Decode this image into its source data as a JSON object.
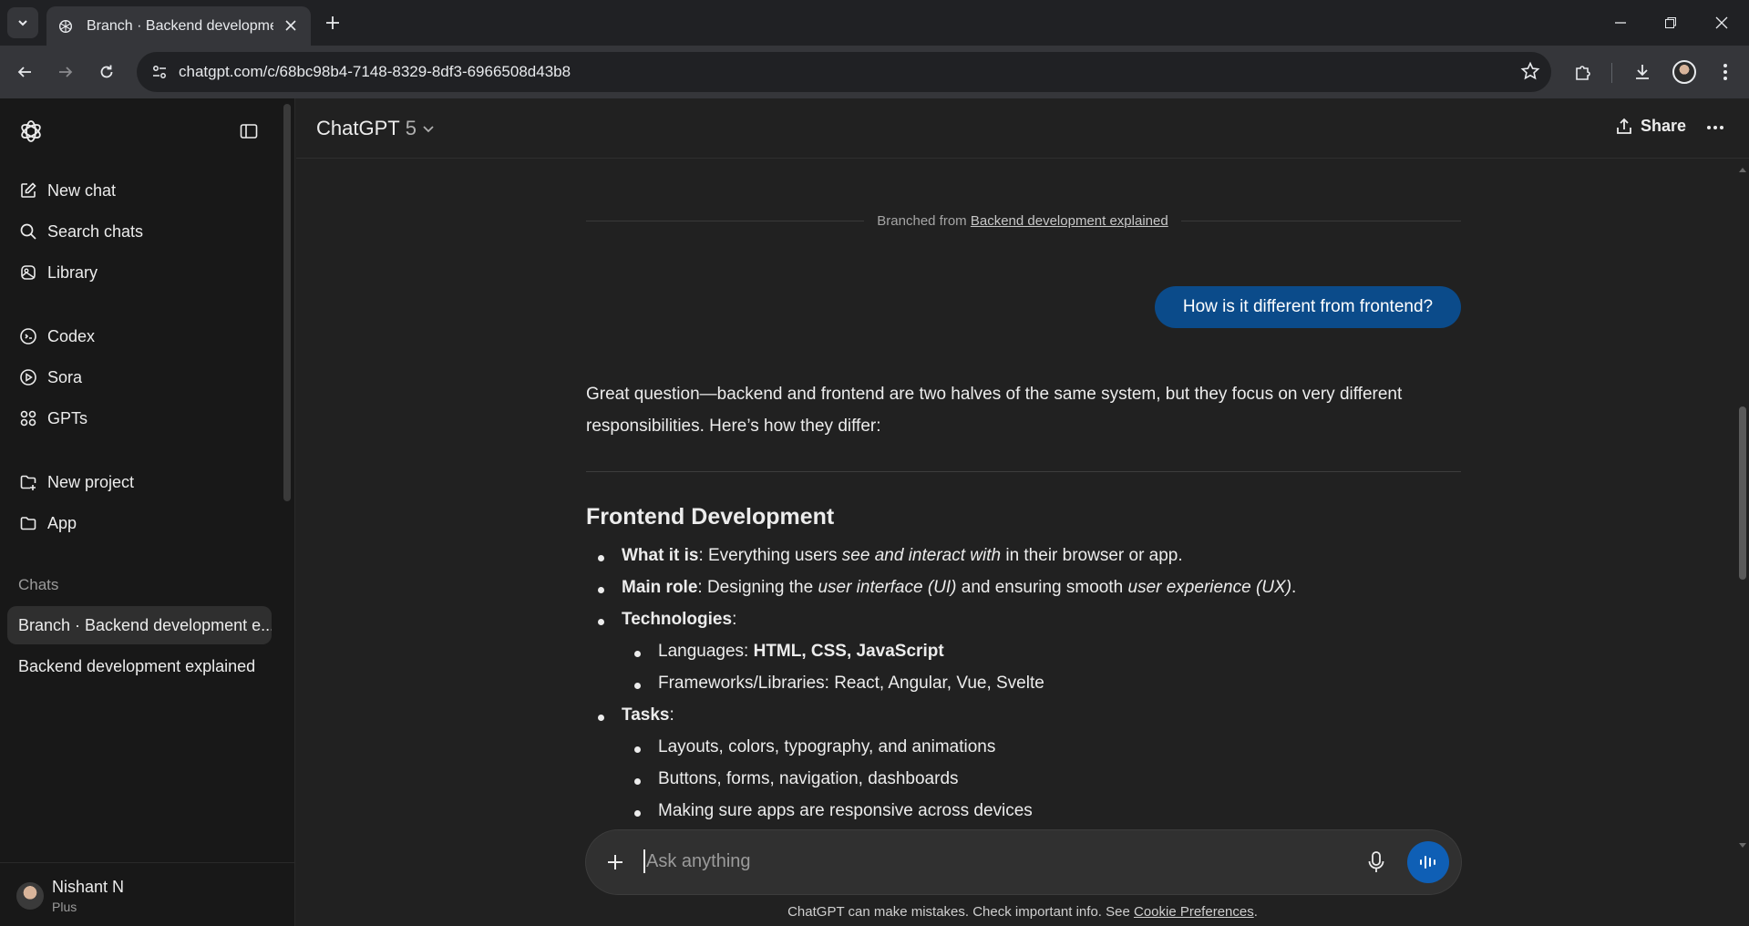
{
  "browser": {
    "tab_title": "Branch · Backend development explained",
    "url": "chatgpt.com/c/68bc98b4-7148-8329-8df3-6966508d43b8"
  },
  "sidebar": {
    "nav": [
      {
        "label": "New chat",
        "icon": "edit-icon"
      },
      {
        "label": "Search chats",
        "icon": "search-icon"
      },
      {
        "label": "Library",
        "icon": "library-icon"
      },
      {
        "label": "Codex",
        "icon": "codex-icon"
      },
      {
        "label": "Sora",
        "icon": "play-circle-icon"
      },
      {
        "label": "GPTs",
        "icon": "grid-icon"
      },
      {
        "label": "New project",
        "icon": "new-folder-icon"
      },
      {
        "label": "App",
        "icon": "folder-icon"
      }
    ],
    "chats_heading": "Chats",
    "chats": [
      {
        "title": "Branch · Backend development e..."
      },
      {
        "title": "Backend development explained"
      }
    ],
    "user": {
      "name": "Nishant N",
      "plan": "Plus"
    }
  },
  "header": {
    "model": "ChatGPT",
    "version": "5",
    "share_label": "Share"
  },
  "conversation": {
    "branch_prefix": "Branched from",
    "branch_link": "Backend development explained",
    "user_message": "How is it different from frontend?",
    "answer_intro": "Great question—backend and frontend are two halves of the same system, but they focus on very different responsibilities. Here’s how they differ:",
    "section_title": "Frontend Development",
    "items": {
      "what_label": "What it is",
      "what_a": ": Everything users ",
      "what_em": "see and interact with",
      "what_b": " in their browser or app.",
      "role_label": "Main role",
      "role_a": ": Designing the ",
      "role_em1": "user interface (UI)",
      "role_b": " and ensuring smooth ",
      "role_em2": "user experience (UX)",
      "role_c": ".",
      "tech_label": "Technologies",
      "tech_colon": ":",
      "lang_prefix": "Languages: ",
      "lang_value": "HTML, CSS, JavaScript",
      "frameworks": "Frameworks/Libraries: React, Angular, Vue, Svelte",
      "tasks_label": "Tasks",
      "tasks_colon": ":",
      "task1": "Layouts, colors, typography, and animations",
      "task2": "Buttons, forms, navigation, dashboards",
      "task3": "Making sure apps are responsive across devices"
    }
  },
  "composer": {
    "placeholder": "Ask anything"
  },
  "footer": {
    "disclaimer": "ChatGPT can make mistakes. Check important info. See ",
    "link": "Cookie Preferences",
    "period": "."
  },
  "colors": {
    "user_bubble": "#0b4b8a",
    "voice_button": "#0f5fb5",
    "background": "#212121",
    "sidebar": "#181818"
  }
}
